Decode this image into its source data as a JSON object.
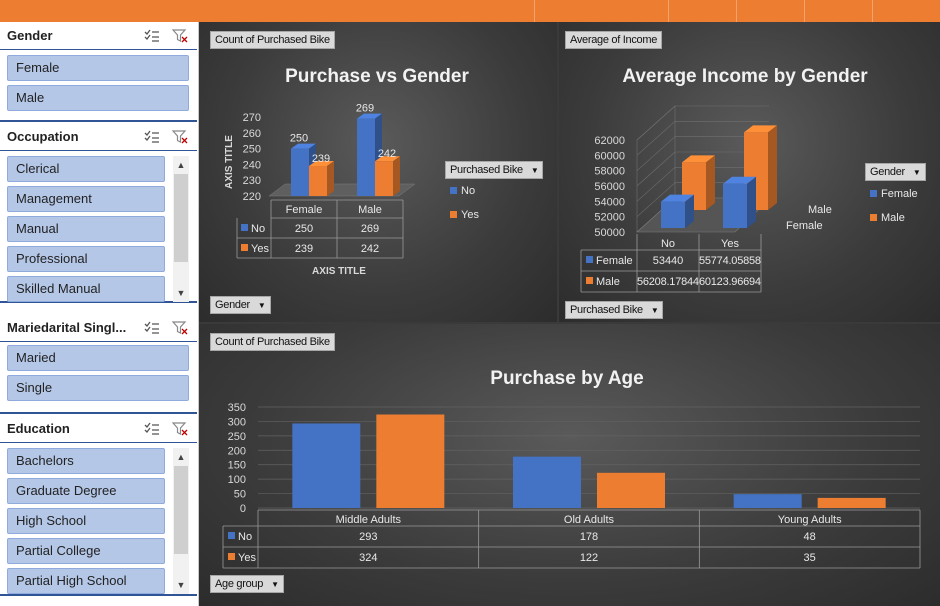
{
  "slicers": {
    "gender": {
      "title": "Gender",
      "items": [
        "Female",
        "Male"
      ]
    },
    "occupation": {
      "title": "Occupation",
      "items": [
        "Clerical",
        "Management",
        "Manual",
        "Professional",
        "Skilled Manual"
      ]
    },
    "marital": {
      "title": "Mariedarital Singl...",
      "items": [
        "Maried",
        "Single"
      ]
    },
    "education": {
      "title": "Education",
      "items": [
        "Bachelors",
        "Graduate Degree",
        "High School",
        "Partial College",
        "Partial High School"
      ]
    }
  },
  "icons": {
    "multiselect": "multi-select-icon",
    "clear_filter": "clear-filter-icon",
    "scroll_up": "chevron-up-icon",
    "scroll_down": "chevron-down-icon",
    "dropdown": "dropdown-caret-icon"
  },
  "colors": {
    "series_no": "#4472c4",
    "series_yes": "#ed7d31",
    "slicer_item": "#b4c7e7",
    "top_bar": "#ed7d31"
  },
  "charts": {
    "gender": {
      "field_tag": "Count of Purchased Bike",
      "title": "Purchase vs Gender",
      "y_axis_title": "AXIS TITLE",
      "x_axis_title": "AXIS TITLE",
      "axis_filter": "Gender",
      "legend_filter": "Purchased Bike",
      "legend": [
        "No",
        "Yes"
      ],
      "y_ticks": [
        "270",
        "260",
        "250",
        "240",
        "230",
        "220"
      ],
      "categories": [
        "Female",
        "Male"
      ],
      "rows": [
        {
          "label": "No",
          "values": [
            "250",
            "269"
          ]
        },
        {
          "label": "Yes",
          "values": [
            "239",
            "242"
          ]
        }
      ]
    },
    "income": {
      "field_tag": "Average of Income",
      "title": "Average Income by Gender",
      "axis_filter": "Purchased Bike",
      "legend_filter": "Gender",
      "legend": [
        "Female",
        "Male"
      ],
      "depth_labels": [
        "Male",
        "Female"
      ],
      "y_ticks": [
        "62000",
        "60000",
        "58000",
        "56000",
        "54000",
        "52000",
        "50000"
      ],
      "categories": [
        "No",
        "Yes"
      ],
      "rows": [
        {
          "label": "Female",
          "values": [
            "53440",
            "55774.05858"
          ]
        },
        {
          "label": "Male",
          "values": [
            "56208.17844",
            "60123.96694"
          ]
        }
      ]
    },
    "age": {
      "field_tag": "Count of Purchased Bike",
      "title": "Purchase by Age",
      "axis_filter": "Age group",
      "y_ticks": [
        "350",
        "300",
        "250",
        "200",
        "150",
        "100",
        "50",
        "0"
      ],
      "categories": [
        "Middle Adults",
        "Old Adults",
        "Young Adults"
      ],
      "rows": [
        {
          "label": "No",
          "values": [
            "293",
            "178",
            "48"
          ]
        },
        {
          "label": "Yes",
          "values": [
            "324",
            "122",
            "35"
          ]
        }
      ]
    }
  },
  "chart_data": [
    {
      "type": "bar",
      "title": "Purchase vs Gender",
      "xlabel": "AXIS TITLE",
      "ylabel": "AXIS TITLE",
      "categories": [
        "Female",
        "Male"
      ],
      "series": [
        {
          "name": "No",
          "values": [
            250,
            269
          ]
        },
        {
          "name": "Yes",
          "values": [
            239,
            242
          ]
        }
      ],
      "ylim": [
        220,
        270
      ],
      "legend": "right"
    },
    {
      "type": "bar",
      "title": "Average Income by Gender",
      "categories": [
        "No",
        "Yes"
      ],
      "series": [
        {
          "name": "Female",
          "values": [
            53440,
            55774.05858
          ]
        },
        {
          "name": "Male",
          "values": [
            56208.17844,
            60123.96694
          ]
        }
      ],
      "ylim": [
        50000,
        62000
      ],
      "legend": "right"
    },
    {
      "type": "bar",
      "title": "Purchase by Age",
      "categories": [
        "Middle Adults",
        "Old Adults",
        "Young Adults"
      ],
      "series": [
        {
          "name": "No",
          "values": [
            293,
            178,
            48
          ]
        },
        {
          "name": "Yes",
          "values": [
            324,
            122,
            35
          ]
        }
      ],
      "ylim": [
        0,
        350
      ],
      "legend": "data-table"
    }
  ]
}
